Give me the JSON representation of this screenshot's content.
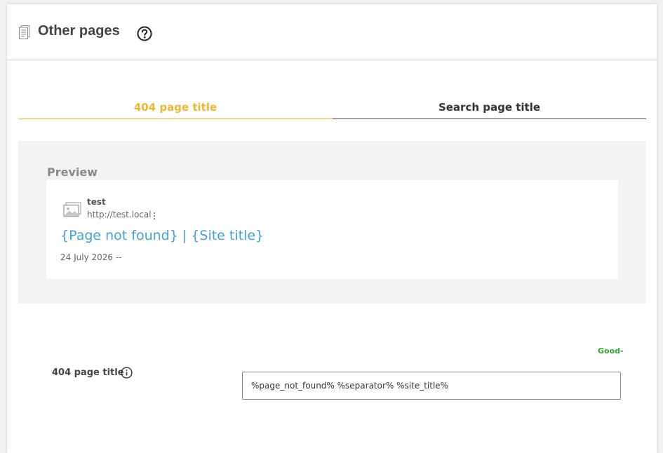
{
  "header": {
    "title": "Other pages",
    "page_icon": "document-icon",
    "help_icon": "help-circle-icon"
  },
  "tabs": [
    {
      "label": "404 page title",
      "active": true
    },
    {
      "label": "Search page title",
      "active": false
    }
  ],
  "preview": {
    "label": "Preview",
    "site_name": "test",
    "site_url": "http://test.local",
    "result_title": "{Page not found} | {Site title}",
    "date": "24 July 2026 --",
    "image_icon": "image-placeholder-icon",
    "more_icon": "more-vertical-icon"
  },
  "field": {
    "label": "404 page title",
    "value": "%page_not_found% %separator% %site_title%",
    "status": "Good-",
    "info_icon": "info-icon"
  },
  "colors": {
    "accent": "#e8b93a",
    "link": "#4aa0c9",
    "good": "#3aa13a"
  }
}
